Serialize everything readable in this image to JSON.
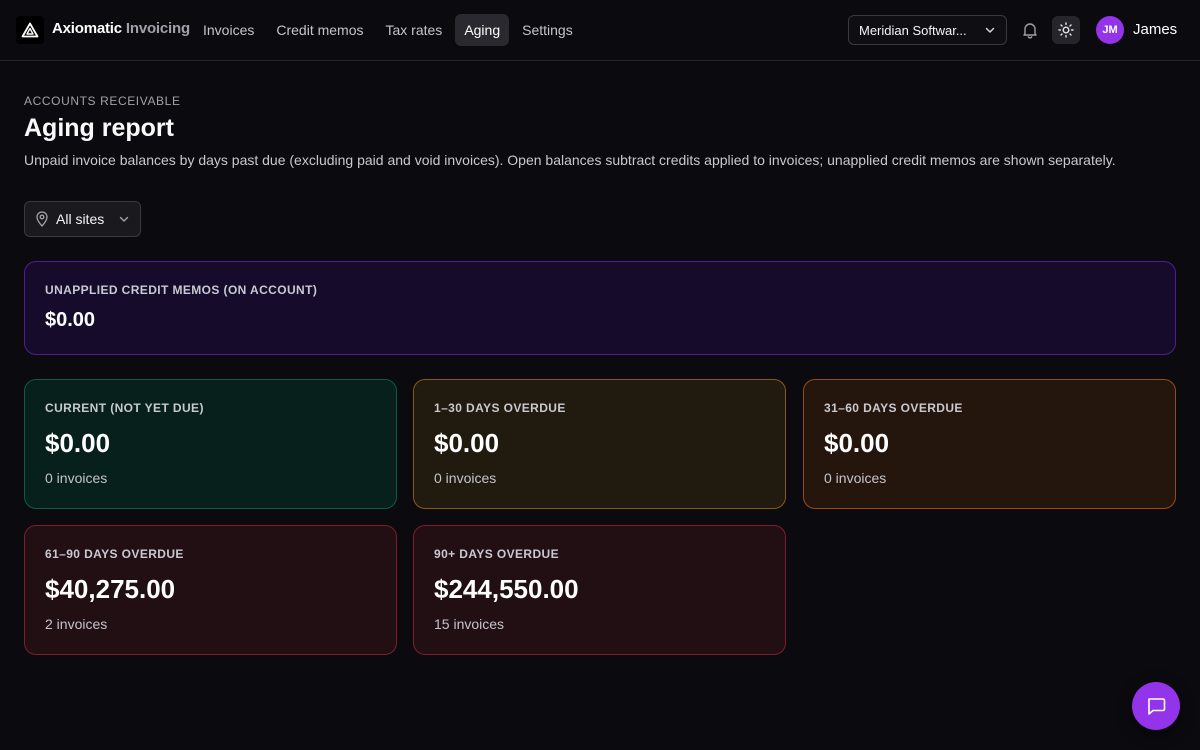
{
  "app": {
    "brand_primary": "Axiomatic",
    "brand_secondary": "Invoicing",
    "logo_icon": "triangle-logo-icon"
  },
  "nav": {
    "items": [
      {
        "label": "Invoices",
        "active": false
      },
      {
        "label": "Credit memos",
        "active": false
      },
      {
        "label": "Tax rates",
        "active": false
      },
      {
        "label": "Aging",
        "active": true
      },
      {
        "label": "Settings",
        "active": false
      }
    ]
  },
  "header_right": {
    "company_select_value": "Meridian Softwar...",
    "notifications_icon": "bell-icon",
    "theme_icon": "sun-icon",
    "avatar_initials": "JM",
    "user_name": "James"
  },
  "page": {
    "eyebrow": "ACCOUNTS RECEIVABLE",
    "title": "Aging report",
    "description": "Unpaid invoice balances by days past due (excluding paid and void invoices). Open balances subtract credits applied to invoices; unapplied credit memos are shown separately.",
    "site_filter_value": "All sites"
  },
  "credit_card": {
    "label": "UNAPPLIED CREDIT MEMOS (ON ACCOUNT)",
    "amount": "$0.00"
  },
  "buckets": [
    {
      "label": "CURRENT (NOT YET DUE)",
      "amount": "$0.00",
      "count": "0 invoices"
    },
    {
      "label": "1–30 DAYS OVERDUE",
      "amount": "$0.00",
      "count": "0 invoices"
    },
    {
      "label": "31–60 DAYS OVERDUE",
      "amount": "$0.00",
      "count": "0 invoices"
    },
    {
      "label": "61–90 DAYS OVERDUE",
      "amount": "$40,275.00",
      "count": "2 invoices"
    },
    {
      "label": "90+ DAYS OVERDUE",
      "amount": "$244,550.00",
      "count": "15 invoices"
    }
  ],
  "colors": {
    "accent": "#9333ea",
    "background": "#0b0a0e"
  },
  "chat": {
    "icon": "chat-bubble-icon"
  }
}
